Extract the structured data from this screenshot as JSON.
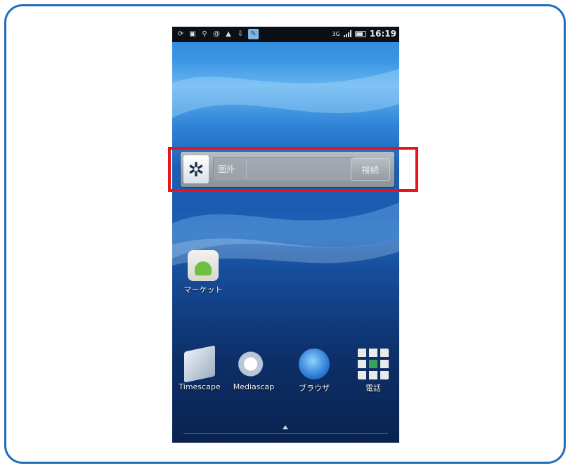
{
  "status_bar": {
    "left_icons": [
      "sync-icon",
      "alarm-icon",
      "usb-icon",
      "at-icon",
      "warning-icon",
      "download-icon",
      "app-notification-icon"
    ],
    "network_label": "3G",
    "time": "16:19"
  },
  "widget": {
    "field_text": "圏外",
    "button_label": "接続"
  },
  "home": {
    "market_label": "マーケット",
    "dock": [
      {
        "label": "Timescape",
        "icon": "timescape-icon"
      },
      {
        "label": "Mediascap",
        "icon": "mediascape-icon"
      },
      {
        "label": "ブラウザ",
        "icon": "browser-icon"
      },
      {
        "label": "電話",
        "icon": "phone-icon"
      }
    ]
  },
  "colors": {
    "frame_border": "#1f6fb8",
    "highlight": "#e8141b",
    "status_bar_bg": "#0b0f16"
  }
}
